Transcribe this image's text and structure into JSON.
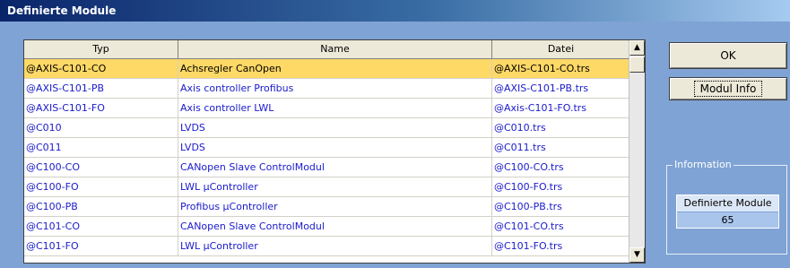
{
  "window": {
    "title": "Definierte Module"
  },
  "table": {
    "columns": [
      "Typ",
      "Name",
      "Datei"
    ],
    "rows": [
      {
        "typ": "@AXIS-C101-CO",
        "name": "Achsregler CanOpen",
        "datei": "@AXIS-C101-CO.trs",
        "selected": true
      },
      {
        "typ": "@AXIS-C101-PB",
        "name": "Axis controller Profibus",
        "datei": "@AXIS-C101-PB.trs"
      },
      {
        "typ": "@AXIS-C101-FO",
        "name": "Axis controller LWL",
        "datei": "@Axis-C101-FO.trs"
      },
      {
        "typ": "@C010",
        "name": "LVDS",
        "datei": "@C010.trs"
      },
      {
        "typ": "@C011",
        "name": "LVDS",
        "datei": "@C011.trs"
      },
      {
        "typ": "@C100-CO",
        "name": "CANopen Slave ControlModul",
        "datei": "@C100-CO.trs"
      },
      {
        "typ": "@C100-FO",
        "name": "LWL µController",
        "datei": "@C100-FO.trs"
      },
      {
        "typ": "@C100-PB",
        "name": "Profibus µController",
        "datei": "@C100-PB.trs"
      },
      {
        "typ": "@C101-CO",
        "name": "CANopen Slave ControlModul",
        "datei": "@C101-CO.trs"
      },
      {
        "typ": "@C101-FO",
        "name": "LWL µController",
        "datei": "@C101-FO.trs"
      }
    ]
  },
  "buttons": {
    "ok": "OK",
    "modul_info": "Modul Info"
  },
  "information": {
    "group_label": "Information",
    "box_title": "Definierte Module",
    "count": "65"
  },
  "scrollbar": {
    "up_icon": "arrow-up-icon",
    "down_icon": "arrow-down-icon"
  }
}
